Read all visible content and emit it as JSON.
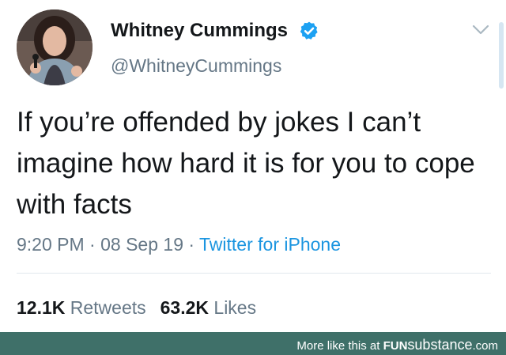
{
  "tweet": {
    "display_name": "Whitney Cummings",
    "handle": "@WhitneyCummings",
    "text": "If you’re offended by jokes I can’t imagine how hard it is for you to cope with facts",
    "time": "9:20 PM",
    "separator": "·",
    "date": "08 Sep 19",
    "source": "Twitter for iPhone",
    "retweets_count": "12.1K",
    "retweets_label": "Retweets",
    "likes_count": "63.2K",
    "likes_label": "Likes"
  },
  "icons": {
    "verified": "verified-badge-icon",
    "menu": "chevron-down-icon"
  },
  "colors": {
    "text": "#14171a",
    "secondary": "#657786",
    "link": "#1b95e0",
    "verified": "#1da1f2",
    "watermark_bar": "#3f7069"
  },
  "watermark": {
    "prefix": "More like this at ",
    "brand_a": "FUN",
    "brand_b": "substance",
    "suffix": ".com"
  }
}
